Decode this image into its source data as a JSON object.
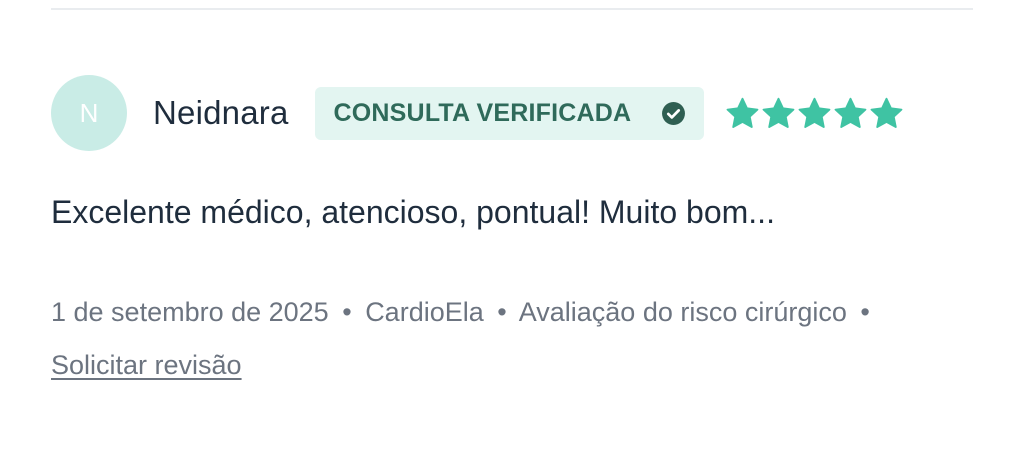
{
  "divider": true,
  "review": {
    "avatar_initial": "N",
    "reviewer_name": "Neidnara",
    "badge": {
      "label": "CONSULTA VERIFICADA",
      "icon": "check-circle-icon"
    },
    "rating": 5,
    "rating_max": 5,
    "star_icon": "star-icon",
    "text": "Excelente médico, atencioso, pontual! Muito bom...",
    "meta": {
      "date": "1 de setembro de 2025",
      "location": "CardioEla",
      "service": "Avaliação do risco cirúrgico",
      "separator": "•",
      "action_link": "Solicitar revisão"
    }
  },
  "colors": {
    "avatar_bg": "#c9ece6",
    "badge_bg": "#e3f5f1",
    "badge_text": "#2f6a5a",
    "star": "#3fc3a3",
    "text_primary": "#1f2d3d",
    "text_secondary": "#6c7480"
  }
}
